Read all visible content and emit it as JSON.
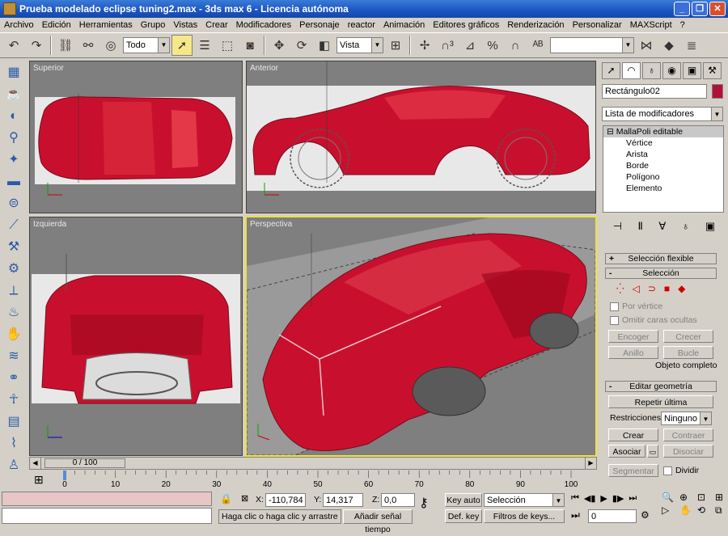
{
  "window": {
    "title": "Prueba modelado eclipse tuning2.max - 3ds max 6 - Licencia autónoma"
  },
  "menu": [
    "Archivo",
    "Edición",
    "Herramientas",
    "Grupo",
    "Vistas",
    "Crear",
    "Modificadores",
    "Personaje",
    "reactor",
    "Animación",
    "Editores gráficos",
    "Renderización",
    "Personalizar",
    "MAXScript",
    "?"
  ],
  "toolbar": {
    "selection_filter": "Todo",
    "ref_coord": "Vista",
    "named_selection": ""
  },
  "viewports": {
    "top": "Superior",
    "front": "Anterior",
    "left": "Izquierda",
    "perspective": "Perspectiva"
  },
  "command_panel": {
    "object_name": "Rectángulo02",
    "object_color": "#b0103a",
    "modifier_list": "Lista de modificadores",
    "stack": {
      "base": "MallaPoli editable",
      "subobjects": [
        "Vértice",
        "Arista",
        "Borde",
        "Polígono",
        "Elemento"
      ]
    },
    "rollouts": {
      "soft": "Selección flexible",
      "selection": "Selección",
      "edit_geometry": "Editar geometría"
    },
    "selection": {
      "by_vertex": "Por vértice",
      "ignore_backfacing": "Omitir caras ocultas",
      "shrink": "Encoger",
      "grow": "Crecer",
      "ring": "Anillo",
      "loop": "Bucle",
      "status": "Objeto completo"
    },
    "edit_geometry": {
      "repeat_last": "Repetir última",
      "constraints_label": "Restricciones:",
      "constraints_value": "Ninguno",
      "create": "Crear",
      "collapse": "Contraer",
      "attach": "Asociar",
      "detach": "Disociar",
      "slice_plane": "Segmentar",
      "split": "Dividir"
    }
  },
  "timeline": {
    "frame": "0 / 100",
    "ticks": [
      "0",
      "10",
      "20",
      "30",
      "40",
      "50",
      "60",
      "70",
      "80",
      "90",
      "100"
    ]
  },
  "status": {
    "x_label": "X:",
    "x_value": "-110,784",
    "y_label": "Y:",
    "y_value": "14,317",
    "z_label": "Z:",
    "z_value": "0,0",
    "prompt": "Haga clic o haga clic y arrastre par",
    "add_time_tag": "Añadir señal tiempo",
    "key_auto": "Key auto",
    "key_set": "Def. key",
    "key_mode": "Selección",
    "key_filters": "Filtros de keys...",
    "current_frame": "0"
  }
}
